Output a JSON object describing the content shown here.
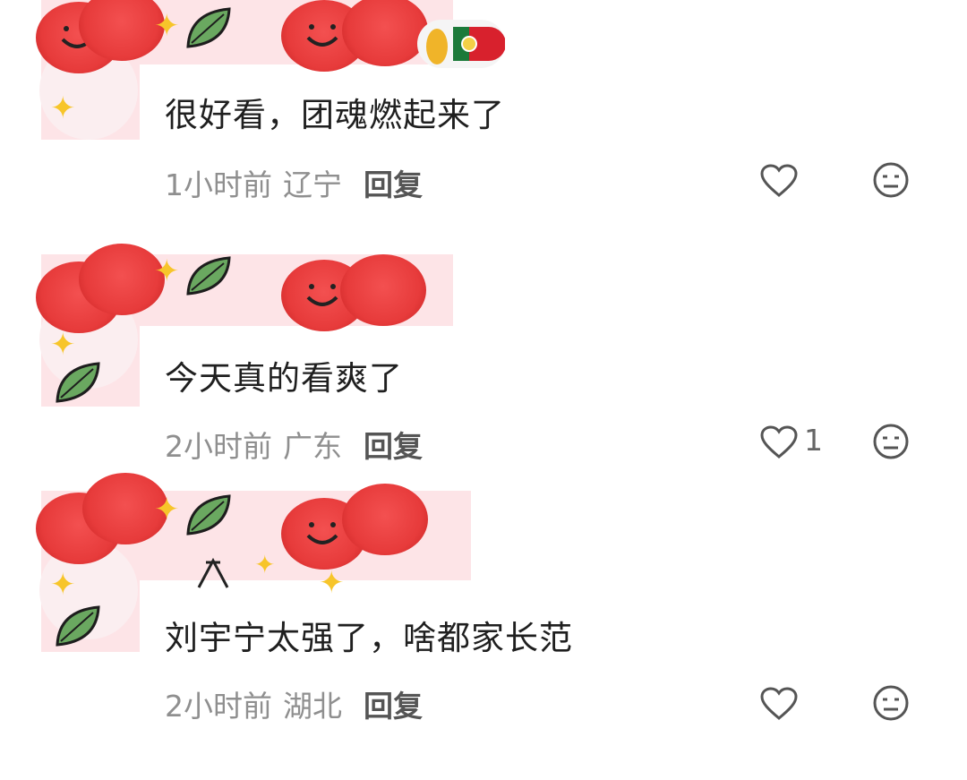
{
  "comments": [
    {
      "text": "很好看，团魂燃起来了",
      "time": "1小时前",
      "location": "辽宁",
      "reply_label": "回复",
      "like_count": ""
    },
    {
      "text": "今天真的看爽了",
      "time": "2小时前",
      "location": "广东",
      "reply_label": "回复",
      "like_count": "1"
    },
    {
      "text": "刘宇宁太强了，啥都家长范",
      "time": "2小时前",
      "location": "湖北",
      "reply_label": "回复",
      "like_count": ""
    }
  ],
  "icons": {
    "like": "heart-outline-icon",
    "emoji": "neutral-face-icon",
    "badge": "portugal-flag-icon"
  },
  "colors": {
    "cherry": "#e73b3b",
    "sparkle": "#f7c52a",
    "leaf": "#6aa860",
    "pink_sticker": "#fde4e7",
    "meta_text": "#8f8f8f"
  }
}
